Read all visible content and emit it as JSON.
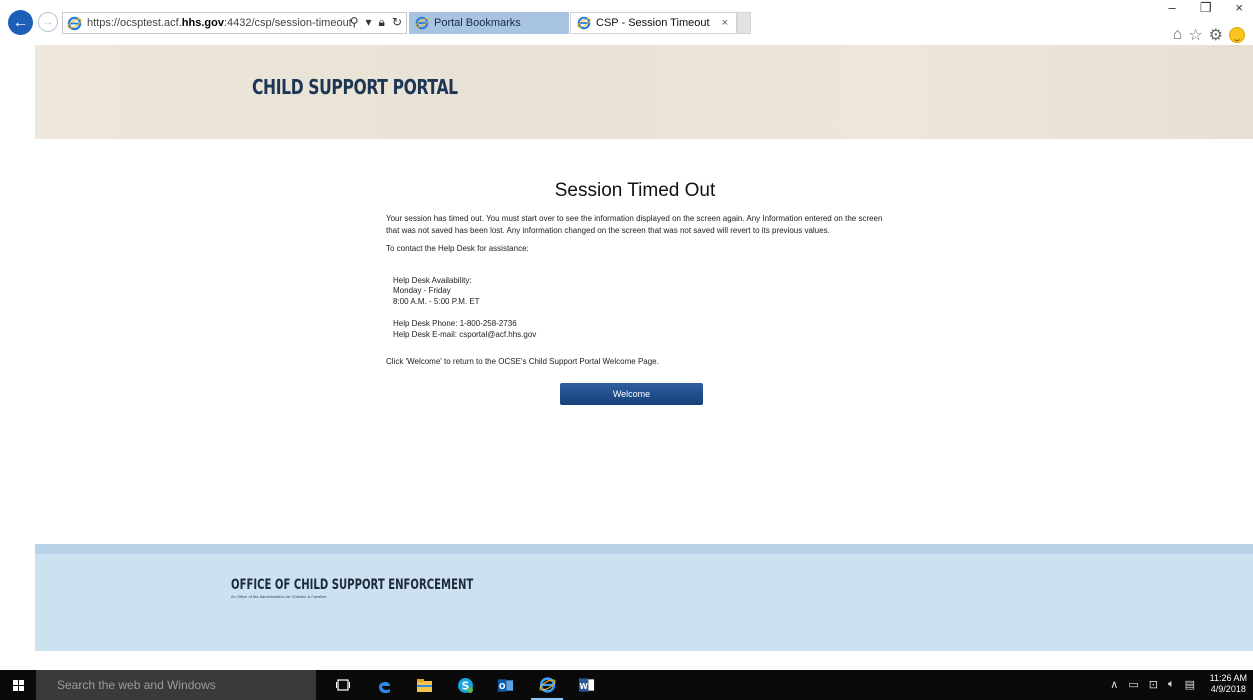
{
  "browser": {
    "url_prefix": "https://ocsptest.acf.",
    "url_domain": "hhs.gov",
    "url_suffix": ":4432/csp/session-timeout",
    "tabs": [
      {
        "label": "Portal Bookmarks"
      },
      {
        "label": "CSP - Session Timeout"
      }
    ],
    "close_tab": "×",
    "window_controls": {
      "minimize": "–",
      "restore": "❐",
      "close": "×"
    }
  },
  "header": {
    "title": "CHILD SUPPORT PORTAL"
  },
  "main": {
    "heading": "Session Timed Out",
    "paragraph1": "Your session has timed out. You must start over to see the information displayed on the screen again. Any Information entered on the screen that was not saved has been lost. Any information changed on the screen that was not saved will revert to its previous values.",
    "paragraph2": "To contact the Help Desk for assistance:",
    "availability_label": "Help Desk Availability:",
    "days": "Monday - Friday",
    "hours": "8:00 A.M. - 5:00 P.M. ET",
    "phone": "Help Desk Phone: 1-800-258-2736",
    "email": "Help Desk E-mail: csportal@acf.hhs.gov",
    "return_note": "Click 'Welcome' to return to the OCSE's Child Support Portal Welcome Page.",
    "welcome_button": "Welcome"
  },
  "footer": {
    "org": "OFFICE OF CHILD SUPPORT ENFORCEMENT",
    "sub": "An Office of the Administration for Children & Families"
  },
  "taskbar": {
    "search_placeholder": "Search the web and Windows",
    "time": "11:26 AM",
    "date": "4/9/2018"
  },
  "colors": {
    "header_text": "#1d3653",
    "button": "#1e4a86",
    "footer_bg": "#cde2f1",
    "active_tab": "#a9c4e2"
  }
}
